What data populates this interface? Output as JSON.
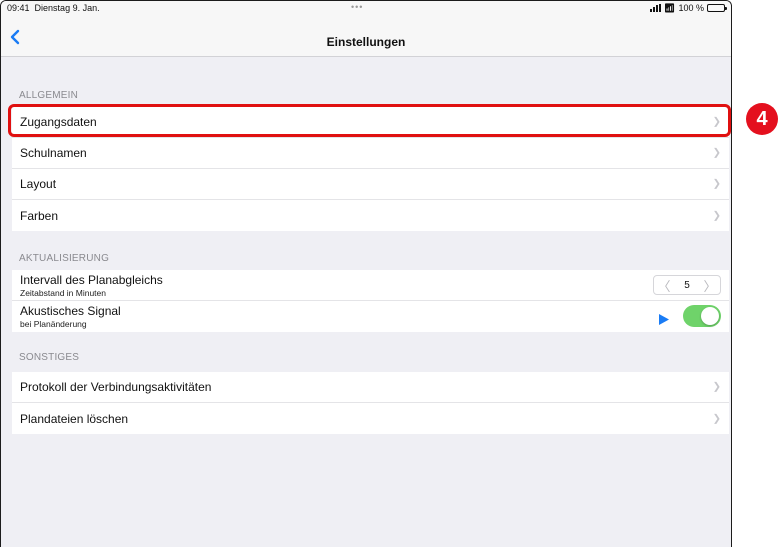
{
  "status_bar": {
    "time": "09:41",
    "date": "Dienstag 9. Jan.",
    "dots": "•••",
    "battery_label": "100 %",
    "icons": [
      "signal-icon",
      "wifi-icon",
      "battery-icon"
    ]
  },
  "nav": {
    "title": "Einstellungen",
    "back_icon": "chevron-left-icon"
  },
  "sections": {
    "allgemein": {
      "header": "ALLGEMEIN",
      "items": [
        {
          "label": "Zugangsdaten"
        },
        {
          "label": "Schulnamen"
        },
        {
          "label": "Layout"
        },
        {
          "label": "Farben"
        }
      ]
    },
    "aktualisierung": {
      "header": "AKTUALISIERUNG",
      "interval": {
        "label": "Intervall des Planabgleichs",
        "sublabel": "Zeitabstand in Minuten",
        "value": "5"
      },
      "signal": {
        "label": "Akustisches Signal",
        "sublabel": "bei Planänderung",
        "enabled": true
      }
    },
    "sonstiges": {
      "header": "SONSTIGES",
      "items": [
        {
          "label": "Protokoll der Verbindungsaktivitäten"
        },
        {
          "label": "Plandateien löschen"
        }
      ]
    }
  },
  "annotation": {
    "step_number": "4",
    "highlighted_item": "Zugangsdaten"
  },
  "colors": {
    "accent": "#1a7cf5",
    "toggle_on": "#6fd36a",
    "highlight": "#e01010",
    "background": "#efeff4"
  }
}
